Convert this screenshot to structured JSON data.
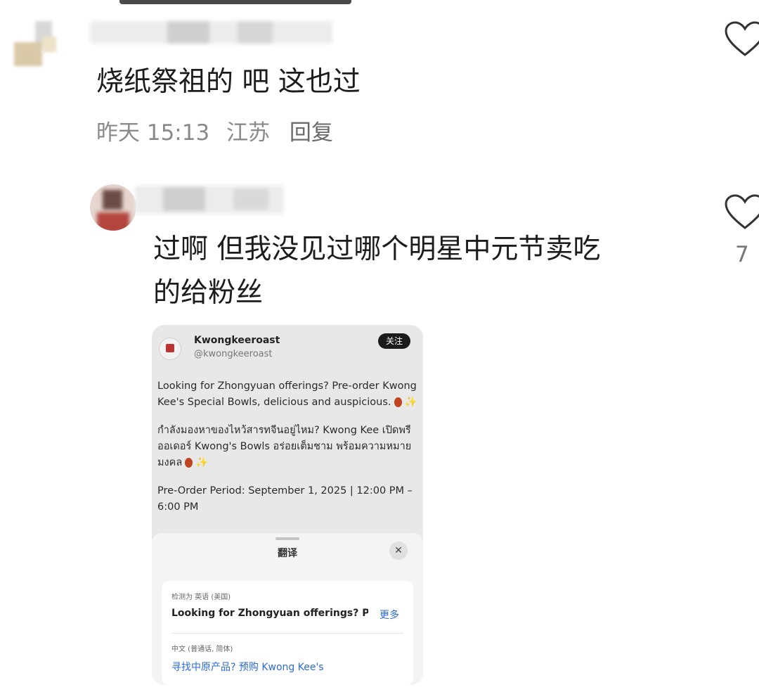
{
  "comments": [
    {
      "text": "烧纸祭祖的 吧  这也过",
      "time": "昨天 15:13",
      "location": "江苏",
      "reply_label": "回复"
    },
    {
      "text_line1": "过啊 但我没见过哪个明星中元节卖吃",
      "text_line2": "的给粉丝",
      "like_count": "7"
    }
  ],
  "embedded_post": {
    "account_name": "Kwongkeeroast",
    "account_handle": "@kwongkeeroast",
    "follow_label": "关注",
    "paragraph_en": "Looking for Zhongyuan offerings? Pre-order Kwong Kee's Special Bowls, delicious and auspicious.",
    "paragraph_th": "กำลังมองหาของไหว้สารทจีนอยู่ไหม? Kwong Kee เปิดพรีออเดอร์ Kwong's Bowls อร่อยเต็มชาม พร้อมความหมายมงคล",
    "paragraph_period": "Pre-Order Period: September 1, 2025 | 12:00 PM – 6:00 PM",
    "translate_sheet": {
      "title": "翻译",
      "close_icon": "close-icon",
      "source_label": "检测为 英语 (美国)",
      "source_text": "Looking for Zhongyuan offerings? Pre",
      "more_label": "更多",
      "target_label": "中文 (普通话, 简体)",
      "target_text": "寻找中原产品? 预购 Kwong Kee's"
    }
  }
}
